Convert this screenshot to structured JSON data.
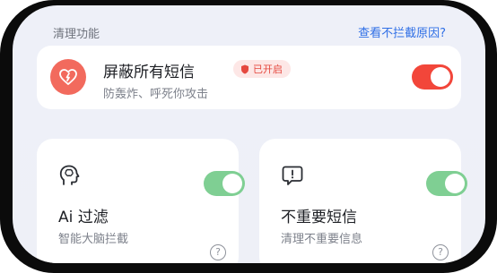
{
  "section": {
    "title": "清理功能",
    "help_link": "查看不拦截原因?"
  },
  "block_all": {
    "title": "屏蔽所有短信",
    "badge": "已开启",
    "subtitle": "防轰炸、呼死你攻击",
    "toggle_on": true,
    "icon": "shield-heart-icon",
    "accent": "#f2463a"
  },
  "ai_filter": {
    "title": "Ai 过滤",
    "subtitle": "智能大脑拦截",
    "toggle_on": true,
    "icon": "brain-head-icon",
    "accent": "#7fcf93"
  },
  "unimportant": {
    "title": "不重要短信",
    "subtitle": "清理不重要信息",
    "toggle_on": true,
    "icon": "message-alert-icon",
    "accent": "#7fcf93"
  }
}
